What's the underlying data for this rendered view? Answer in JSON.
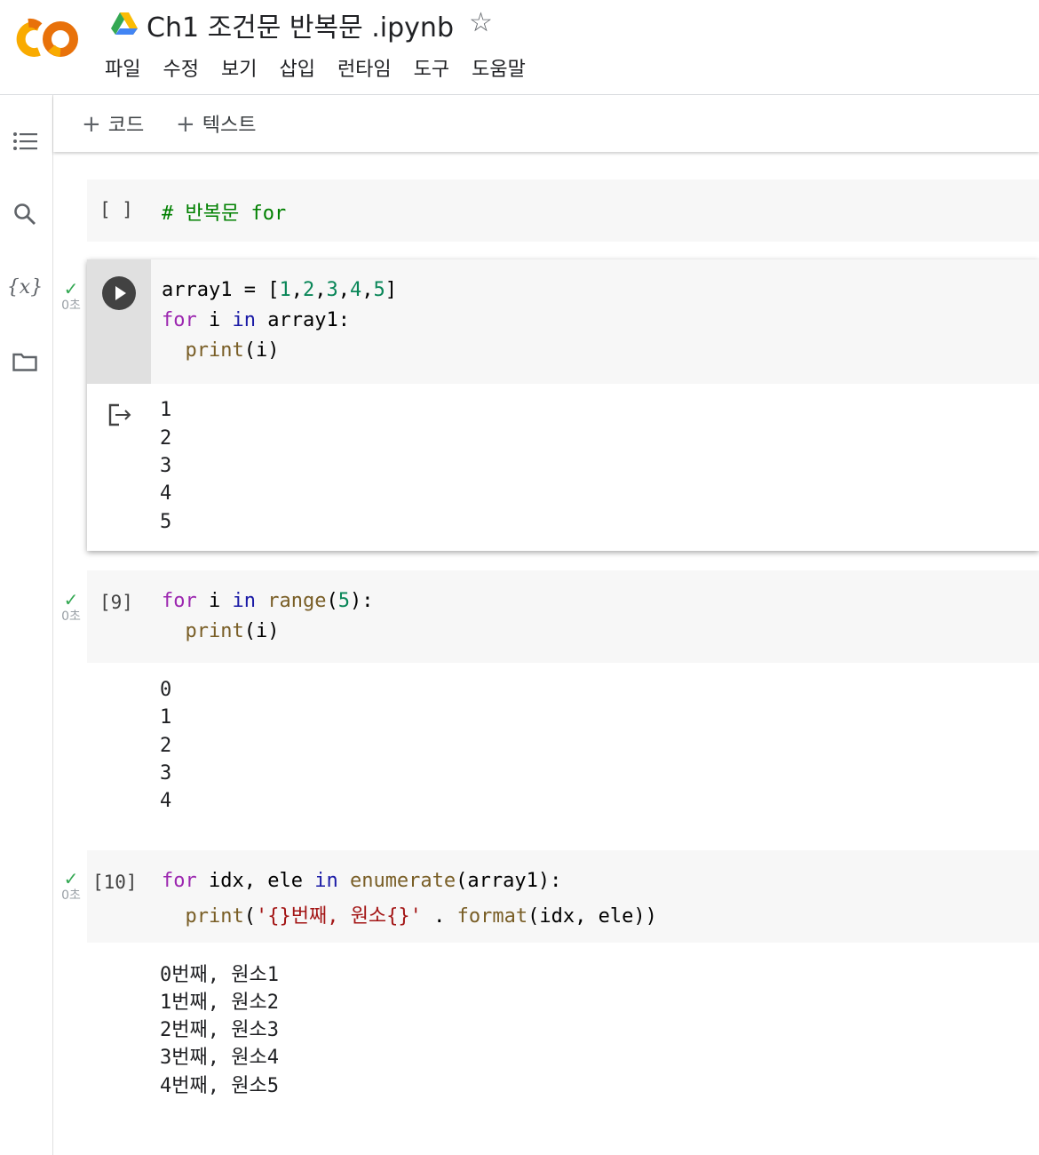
{
  "header": {
    "title": "Ch1 조건문 반복문 .ipynb",
    "menu": [
      "파일",
      "수정",
      "보기",
      "삽입",
      "런타임",
      "도구",
      "도움말"
    ]
  },
  "toolbar": {
    "add_code": "코드",
    "add_text": "텍스트"
  },
  "cells": {
    "c1": {
      "exec": "[ ]",
      "code": [
        "# 반복문 for"
      ]
    },
    "c2": {
      "status": "0초",
      "code": [
        "array1 = [1,2,3,4,5]",
        "for i in array1:",
        "  print(i)"
      ],
      "output": [
        "1",
        "2",
        "3",
        "4",
        "5"
      ]
    },
    "c3": {
      "exec": "[9]",
      "status": "0초",
      "code": [
        "for i in range(5):",
        "  print(i)"
      ],
      "output": [
        "0",
        "1",
        "2",
        "3",
        "4"
      ]
    },
    "c4": {
      "exec": "[10]",
      "status": "0초",
      "code": [
        "for idx, ele in enumerate(array1):",
        "  print('{}번째, 원소{}' . format(idx, ele))"
      ],
      "output": [
        "0번째, 원소1",
        "1번째, 원소2",
        "2번째, 원소3",
        "3번째, 원소4",
        "4번째, 원소5"
      ]
    }
  },
  "colors": {
    "logo_orange": "#E8710A",
    "logo_yellow": "#F9AB00",
    "check_green": "#34a853",
    "keyword_purple": "#9C27B0",
    "keyword_blue": "#1a1aa6",
    "function_brown": "#795E26",
    "number_green": "#098658",
    "string_red": "#a31515",
    "comment_green": "#008000"
  }
}
